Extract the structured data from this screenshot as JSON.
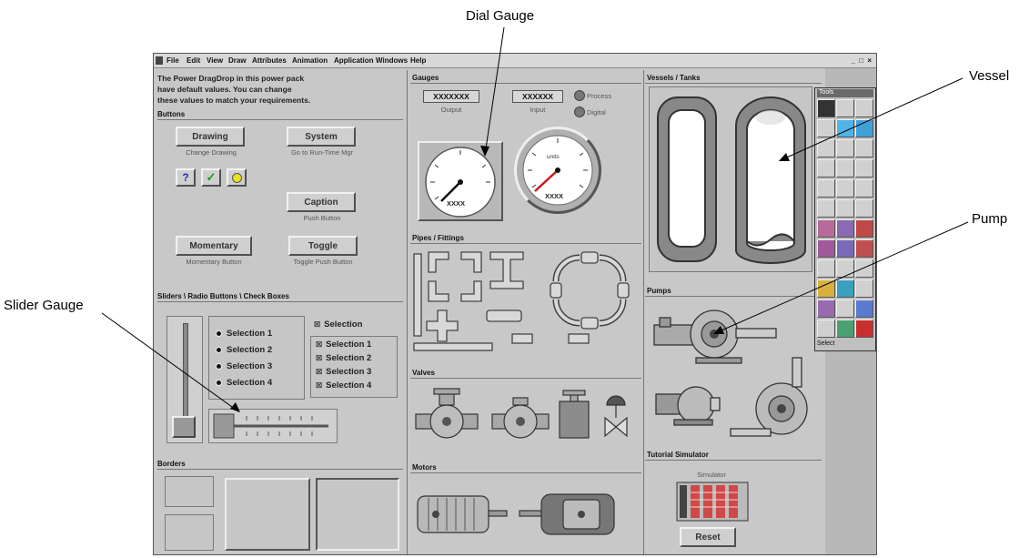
{
  "callouts": {
    "dial_gauge": "Dial Gauge",
    "vessel": "Vessel",
    "pump": "Pump",
    "slider_gauge": "Slider Gauge"
  },
  "menu": [
    "File",
    "Edit",
    "View",
    "Draw",
    "Attributes",
    "Animation",
    "Application",
    "Windows",
    "Help"
  ],
  "window_controls": "_ □ ×",
  "intro": {
    "line1": "The Power DragDrop in this power pack",
    "line2": "have default values. You can change",
    "line3": "these values to match your requirements."
  },
  "buttons_panel": {
    "title": "Buttons",
    "drawing": "Drawing",
    "drawing_sub": "Change Drawing",
    "system": "System",
    "system_sub": "Go to Run-Time Mgr",
    "caption": "Caption",
    "caption_sub": "Push Button",
    "momentary": "Momentary",
    "momentary_sub": "Momentary Button",
    "toggle": "Toggle",
    "toggle_sub": "Toggle Push Button",
    "question_glyph": "?",
    "check_glyph": "✓"
  },
  "sliders_panel": {
    "title": "Sliders \\ Radio Buttons \\ Check Boxes",
    "radios": [
      "Selection 1",
      "Selection 2",
      "Selection 3",
      "Selection 4"
    ],
    "single_check": "Selection",
    "checks": [
      "Selection 1",
      "Selection 2",
      "Selection 3",
      "Selection 4"
    ]
  },
  "borders_panel": {
    "title": "Borders"
  },
  "gauges_panel": {
    "title": "Gauges",
    "output_value": "XXXXXXX",
    "output_label": "Output",
    "input_value": "XXXXXX",
    "input_label": "Input",
    "process_label": "Process",
    "digital_label": "Digital",
    "dial1_readout": "XXXX",
    "dial2_readout": "XXXX",
    "dial2_unit": "units"
  },
  "pipes_panel": {
    "title": "Pipes / Fittings"
  },
  "valves_panel": {
    "title": "Valves"
  },
  "motors_panel": {
    "title": "Motors"
  },
  "vessels_panel": {
    "title": "Vessels / Tanks"
  },
  "pumps_panel": {
    "title": "Pumps"
  },
  "tutorial_panel": {
    "title": "Tutorial Simulator",
    "sim_label": "Simulator",
    "reset": "Reset"
  },
  "toolbox": {
    "title": "Tools",
    "status": "Select"
  }
}
